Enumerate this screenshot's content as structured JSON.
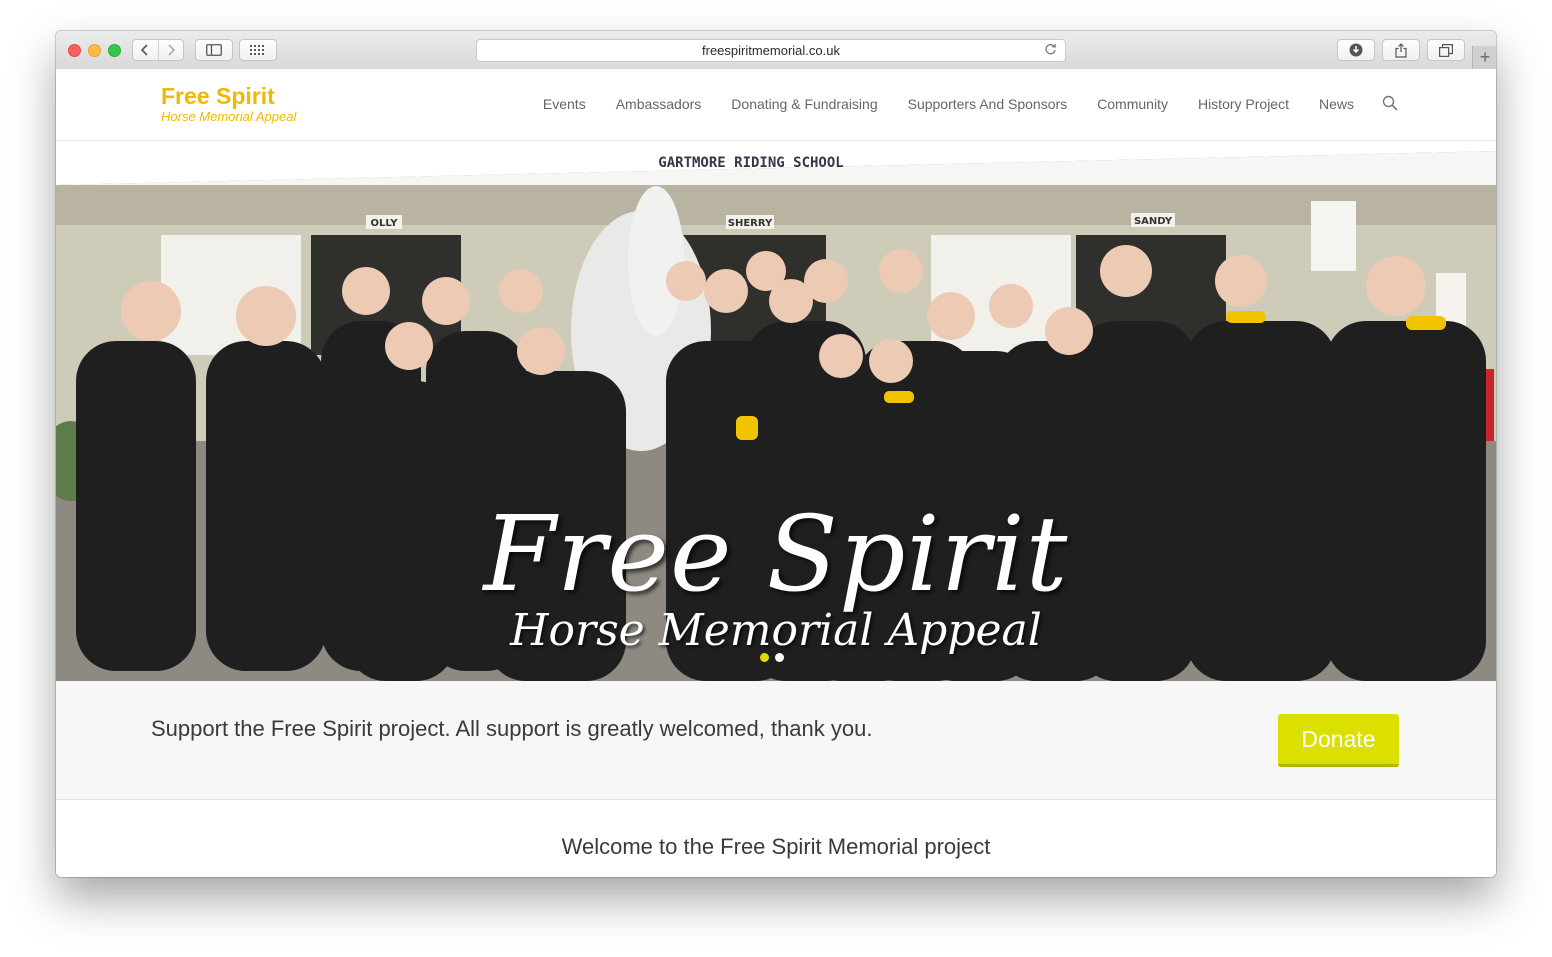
{
  "browser": {
    "url": "freespiritmemorial.co.uk",
    "new_tab_symbol": "+"
  },
  "site": {
    "logo_title": "Free Spirit",
    "logo_subtitle": "Horse Memorial Appeal"
  },
  "nav": {
    "items": [
      {
        "label": "Events"
      },
      {
        "label": "Ambassadors"
      },
      {
        "label": "Donating & Fundraising"
      },
      {
        "label": "Supporters And Sponsors"
      },
      {
        "label": "Community"
      },
      {
        "label": "History Project"
      },
      {
        "label": "News"
      }
    ]
  },
  "hero": {
    "sign": "GARTMORE RIDING SCHOOL",
    "stables": [
      "OLLY",
      "SHERRY",
      "SANDY"
    ],
    "title": "Free Spirit",
    "subtitle": "Horse Memorial Appeal",
    "slide_count": 2,
    "active_slide": 1
  },
  "cta": {
    "text": "Support the Free Spirit project. All support is greatly welcomed, thank you.",
    "button_label": "Donate"
  },
  "content": {
    "welcome": "Welcome to the Free Spirit Memorial project"
  },
  "colors": {
    "brand": "#f0b800",
    "donate": "#dbe000",
    "slider_active": "#e5da00"
  }
}
